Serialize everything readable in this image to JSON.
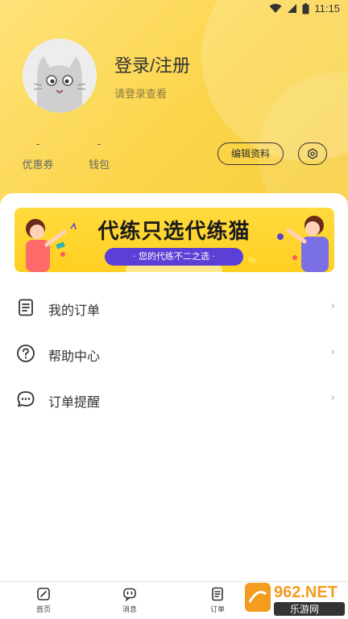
{
  "status_bar": {
    "time": "11:15"
  },
  "profile": {
    "username": "登录/注册",
    "hint": "请登录查看"
  },
  "stats": [
    {
      "value": "-",
      "label": "优惠券"
    },
    {
      "value": "-",
      "label": "钱包"
    }
  ],
  "buttons": {
    "edit_profile": "编辑资料"
  },
  "banner": {
    "title": "代练只选代练猫",
    "tagline": "· 您的代练不二之选 ·"
  },
  "menu": [
    {
      "label": "我的订单",
      "icon": "order-list-icon"
    },
    {
      "label": "帮助中心",
      "icon": "question-icon"
    },
    {
      "label": "订单提醒",
      "icon": "chat-bubble-icon"
    }
  ],
  "menu_arrow": "›",
  "tabs": [
    {
      "label": "首页",
      "icon": "home-icon"
    },
    {
      "label": "消息",
      "icon": "message-icon"
    },
    {
      "label": "订单",
      "icon": "order-icon"
    }
  ],
  "watermark": {
    "brand": "962.NET",
    "sub": "乐游网"
  },
  "colors": {
    "header_yellow": "#fbd54a",
    "banner_yellow": "#ffd430",
    "pill_purple": "#5b3fd6"
  }
}
